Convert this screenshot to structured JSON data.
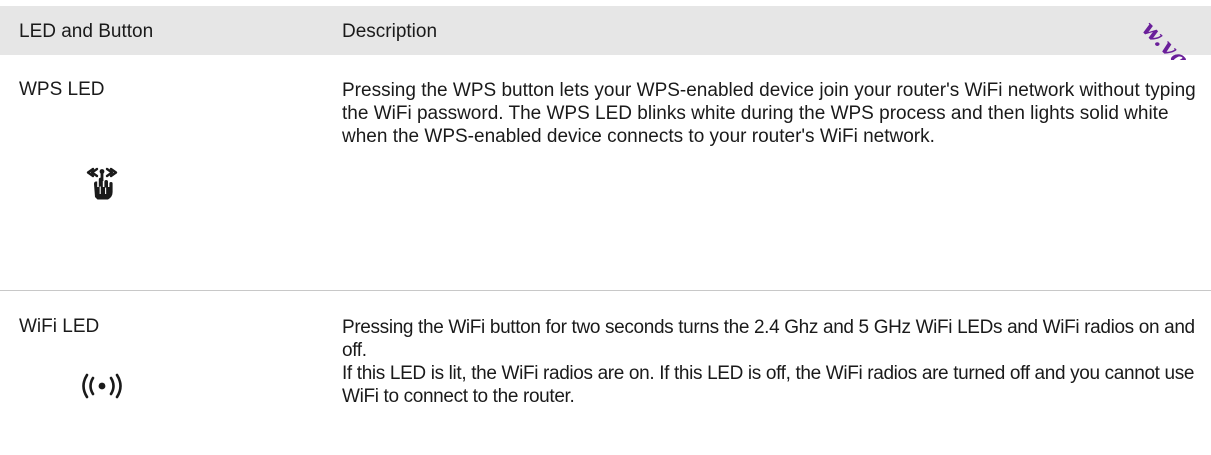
{
  "table": {
    "headers": {
      "led_and_button": "LED and Button",
      "description": "Description"
    },
    "rows": [
      {
        "name": "WPS LED",
        "icon": "wps-icon",
        "description": [
          "Pressing the WPS button lets your WPS-enabled device join your router's WiFi network without typing the WiFi password. The WPS LED blinks white during the WPS process and then lights solid white when the WPS-enabled device connects to your router's WiFi network."
        ]
      },
      {
        "name": "WiFi LED",
        "icon": "wifi-icon",
        "description": [
          "Pressing the WiFi button for two seconds turns the 2.4 Ghz and 5 GHz WiFi LEDs and WiFi radios on and off.",
          "If this LED is lit, the WiFi radios are on. If this LED is off, the WiFi radios are turned off and you cannot use WiFi to connect to the router."
        ]
      }
    ]
  },
  "watermark": {
    "text": "w.va"
  },
  "colors": {
    "header_background": "#e6e6e6",
    "divider": "#c8c8c8",
    "watermark": "#6a1f9a",
    "text": "#1a1a1a"
  }
}
